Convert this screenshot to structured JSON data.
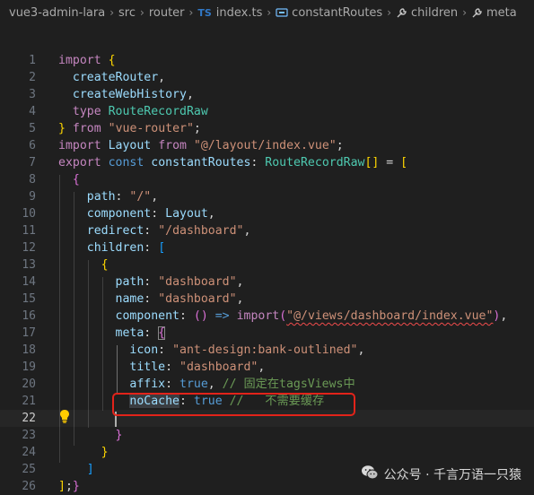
{
  "breadcrumb": {
    "items": [
      {
        "label": "vue3-admin-lara",
        "icon": ""
      },
      {
        "label": "src",
        "icon": ""
      },
      {
        "label": "router",
        "icon": ""
      },
      {
        "label": "index.ts",
        "icon": "typescript-file-icon",
        "badge": "TS"
      },
      {
        "label": "constantRoutes",
        "icon": "variable-icon"
      },
      {
        "label": "children",
        "icon": "wrench-icon"
      },
      {
        "label": "meta",
        "icon": "wrench-icon"
      }
    ]
  },
  "editor": {
    "current_line": 22,
    "lines": [
      {
        "num": "1"
      },
      {
        "num": "2"
      },
      {
        "num": "3"
      },
      {
        "num": "4"
      },
      {
        "num": "5"
      },
      {
        "num": "6"
      },
      {
        "num": "7"
      },
      {
        "num": "8"
      },
      {
        "num": "9"
      },
      {
        "num": "10"
      },
      {
        "num": "11"
      },
      {
        "num": "12"
      },
      {
        "num": "13"
      },
      {
        "num": "14"
      },
      {
        "num": "15"
      },
      {
        "num": "16"
      },
      {
        "num": "17"
      },
      {
        "num": "18"
      },
      {
        "num": "19"
      },
      {
        "num": "20"
      },
      {
        "num": "21"
      },
      {
        "num": "22"
      },
      {
        "num": "23"
      },
      {
        "num": "24"
      },
      {
        "num": "25"
      },
      {
        "num": "26"
      }
    ],
    "tokens": {
      "import": "import",
      "from": "from",
      "type": "type",
      "export": "export",
      "const": "const",
      "true": "true",
      "createRouter": "createRouter",
      "createWebHistory": "createWebHistory",
      "RouteRecordRaw": "RouteRecordRaw",
      "vue_router": "\"vue-router\"",
      "Layout": "Layout",
      "layout_path": "\"@/layout/index.vue\"",
      "constantRoutes": "constantRoutes",
      "path": "path",
      "component": "component",
      "redirect": "redirect",
      "children": "children",
      "name": "name",
      "meta": "meta",
      "icon": "icon",
      "title": "title",
      "affix": "affix",
      "noCache": "noCache",
      "slash": "\"/\"",
      "slash_dashboard": "\"/dashboard\"",
      "dashboard": "\"dashboard\"",
      "dashboard_view": "\"@/views/dashboard/index.vue\"",
      "ant_icon": "\"ant-design:bank-outlined\"",
      "comment_affix": "// 固定在tagsViews中",
      "comment_nocache": "//   不需要缓存"
    }
  },
  "watermark": {
    "text": "公众号 · 千言万语一只猿",
    "icon": "wechat-icon"
  },
  "colors": {
    "highlight_box": "#e2231a",
    "background": "#1f1f1f"
  }
}
